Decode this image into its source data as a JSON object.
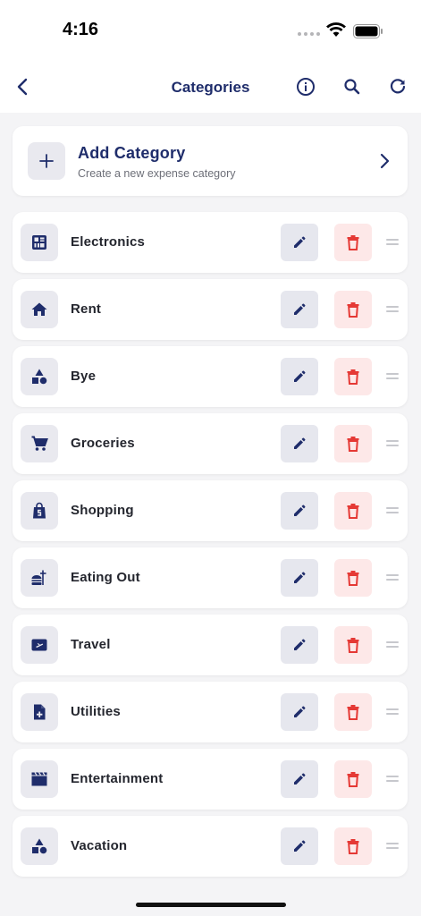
{
  "status": {
    "time": "4:16"
  },
  "nav": {
    "title": "Categories"
  },
  "add_category": {
    "title": "Add Category",
    "subtitle": "Create a new expense category"
  },
  "categories": [
    {
      "label": "Electronics",
      "icon": "electronics-icon"
    },
    {
      "label": "Rent",
      "icon": "home-icon"
    },
    {
      "label": "Bye",
      "icon": "category-shapes-icon"
    },
    {
      "label": "Groceries",
      "icon": "cart-icon"
    },
    {
      "label": "Shopping",
      "icon": "shopping-bag-icon"
    },
    {
      "label": "Eating Out",
      "icon": "fastfood-icon"
    },
    {
      "label": "Travel",
      "icon": "ticket-icon"
    },
    {
      "label": "Utilities",
      "icon": "document-add-icon"
    },
    {
      "label": "Entertainment",
      "icon": "clapperboard-icon"
    },
    {
      "label": "Vacation",
      "icon": "category-shapes-icon"
    }
  ],
  "colors": {
    "accent": "#1f2d6b",
    "delete": "#e53935",
    "delete_bg": "#fde8e8",
    "edit_bg": "#e6e7ee",
    "background": "#f4f4f6"
  }
}
